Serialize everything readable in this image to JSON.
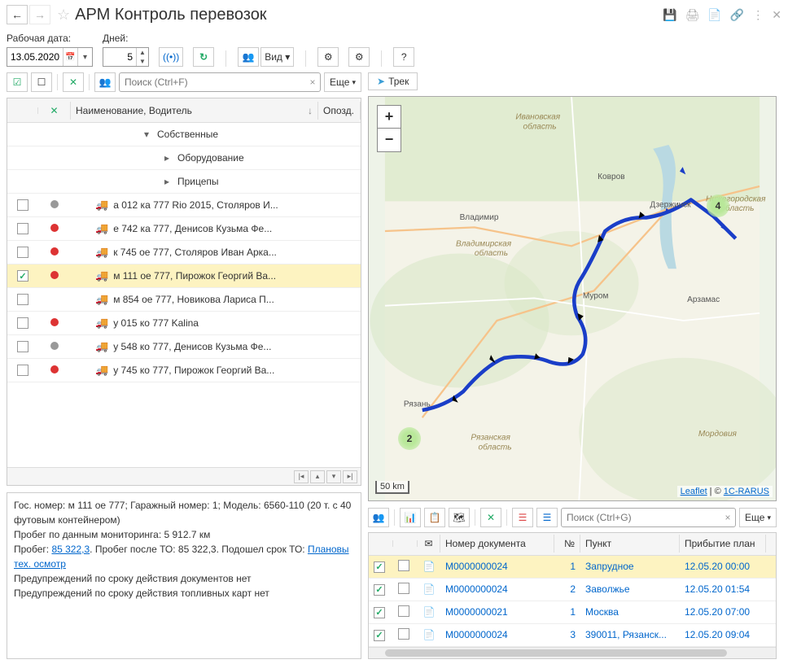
{
  "header": {
    "title": "АРМ Контроль перевозок"
  },
  "toolbar": {
    "date_label": "Рабочая дата:",
    "date_value": "13.05.2020",
    "days_label": "Дней:",
    "days_value": "5",
    "view_label": "Вид",
    "search_placeholder": "Поиск (Ctrl+F)",
    "more_label": "Еще"
  },
  "table": {
    "col_name": "Наименование, Водитель",
    "col_late": "Опозд.",
    "group_own": "Собственные",
    "group_equip": "Оборудование",
    "group_trailers": "Прицепы",
    "rows": [
      {
        "status": "gray",
        "name": "а 012 ка 777 Rio 2015, Столяров И...",
        "checked": false
      },
      {
        "status": "red",
        "name": "е 742 ка 777, Денисов Кузьма Фе...",
        "checked": false
      },
      {
        "status": "red",
        "name": "к 745 ое 777, Столяров Иван Арка...",
        "checked": false
      },
      {
        "status": "red",
        "name": "м 111 ое 777, Пирожок Георгий Ва...",
        "checked": true
      },
      {
        "status": "",
        "name": "м 854 ое 777, Новикова Лариса П...",
        "checked": false
      },
      {
        "status": "red",
        "name": "у 015 ко 777 Kalina",
        "checked": false
      },
      {
        "status": "gray",
        "name": "у 548 ко 777, Денисов Кузьма Фе...",
        "checked": false
      },
      {
        "status": "red",
        "name": "у 745 ко 777, Пирожок Георгий Ва...",
        "checked": false
      }
    ]
  },
  "info": {
    "line1a": "Гос. номер: м 111 ое 777; Гаражный номер: 1; Модель: 6560-110 (20 т. с 40 футовым контейнером)",
    "line2": "Пробег по данным мониторинга: 5 912.7 км",
    "line3_prefix": "Пробег: ",
    "line3_link": "85 322,3",
    "line3_mid": ". Пробег после ТО: 85 322,3. Подошел срок ТО: ",
    "line3_link2": "Плановы тех. осмотр",
    "line4": "Предупреждений по сроку действия документов нет",
    "line5": "Предупреждений по сроку действия топливных карт нет"
  },
  "map": {
    "track_btn": "Трек",
    "scale": "50 km",
    "attrib_leaflet": "Leaflet",
    "attrib_1c": "1C-RARUS",
    "marker1": "2",
    "marker2": "4",
    "cities": {
      "ivanovo": "Ивановская область",
      "kovrov": "Ковров",
      "dzerzhinsk": "Дзержинск",
      "vladimir": "Владимир",
      "vladimir_obl": "Владимирская область",
      "murom": "Муром",
      "arzamas": "Арзамас",
      "nizh": "Нижегородская область",
      "ryazan": "Рязань",
      "ryazan_obl": "Рязанская область",
      "mordovia": "Мордовия"
    }
  },
  "docs": {
    "search_placeholder": "Поиск (Ctrl+G)",
    "more_label": "Еще",
    "col_doc": "Номер документа",
    "col_num": "№",
    "col_point": "Пункт",
    "col_arr": "Прибытие план",
    "rows": [
      {
        "checked": true,
        "doc": "М0000000024",
        "num": "1",
        "point": "Запрудное",
        "arr": "12.05.20 00:00",
        "sel": true
      },
      {
        "checked": true,
        "doc": "М0000000024",
        "num": "2",
        "point": "Заволжье",
        "arr": "12.05.20 01:54",
        "sel": false
      },
      {
        "checked": true,
        "doc": "М0000000021",
        "num": "1",
        "point": "Москва",
        "arr": "12.05.20 07:00",
        "sel": false
      },
      {
        "checked": true,
        "doc": "М0000000024",
        "num": "3",
        "point": "390011, Рязанск...",
        "arr": "12.05.20 09:04",
        "sel": false
      }
    ]
  }
}
